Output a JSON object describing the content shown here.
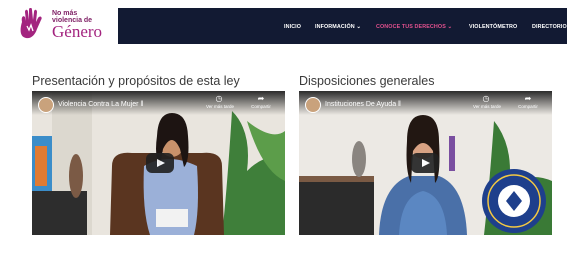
{
  "logo": {
    "line1": "No más",
    "line2": "violencia de",
    "line3": "Género",
    "color": "#a3247f"
  },
  "nav": {
    "items": [
      {
        "label": "INICIO",
        "active": false
      },
      {
        "label": "INFORMACIÓN ⌄",
        "active": false
      },
      {
        "label": "CONOCE TUS DERECHOS ⌄",
        "active": true
      },
      {
        "label": "VIOLENTÓMETRO",
        "active": false
      },
      {
        "label": "DIRECTORIO",
        "active": false
      }
    ],
    "background": "#121a33",
    "active_color": "#e0508d"
  },
  "sections": [
    {
      "title": "Presentación y propósitos de esta ley",
      "video": {
        "title": "Violencia Contra La Mujer ‖",
        "watch_later": "Ver más tarde",
        "share": "Compartir"
      }
    },
    {
      "title": "Disposiciones generales",
      "video": {
        "title": "Instituciones De Ayuda ‖",
        "watch_later": "Ver más tarde",
        "share": "Compartir"
      }
    }
  ]
}
